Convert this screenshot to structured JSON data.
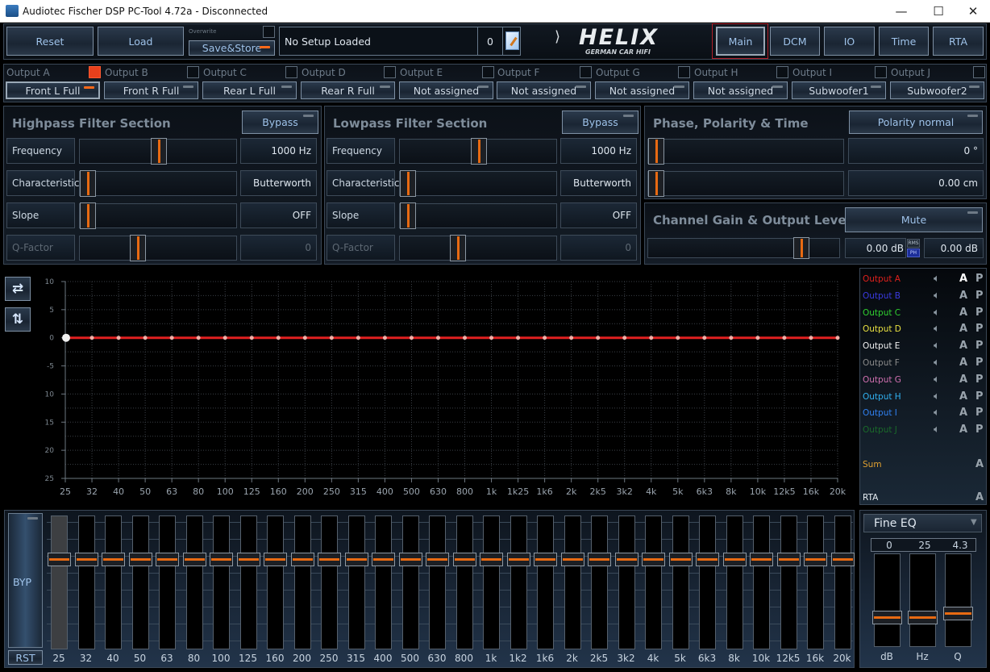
{
  "window": {
    "title": "Audiotec Fischer DSP PC-Tool 4.72a - Disconnected",
    "minimize": "—",
    "maximize": "☐",
    "close": "✕"
  },
  "toolbar": {
    "reset": "Reset",
    "load": "Load",
    "overwrite_label": "Overwrite",
    "overwrite_checked": false,
    "save_store": "Save&Store",
    "setup_name": "No Setup Loaded",
    "setup_number": "0",
    "edit_icon": "edit-document-icon",
    "logo_text": "HELIX",
    "logo_sub": "GERMAN CAR HIFI",
    "nav": [
      {
        "label": "Main",
        "active": true
      },
      {
        "label": "DCM",
        "active": false
      },
      {
        "label": "IO",
        "active": false
      },
      {
        "label": "Time",
        "active": false
      },
      {
        "label": "RTA",
        "active": false
      }
    ]
  },
  "outputs": [
    {
      "label": "Output A",
      "name": "Front L Full",
      "linked": true,
      "selected": true
    },
    {
      "label": "Output B",
      "name": "Front R Full",
      "linked": false,
      "selected": false
    },
    {
      "label": "Output C",
      "name": "Rear L Full",
      "linked": false,
      "selected": false
    },
    {
      "label": "Output D",
      "name": "Rear R Full",
      "linked": false,
      "selected": false
    },
    {
      "label": "Output E",
      "name": "Not assigned",
      "linked": false,
      "selected": false
    },
    {
      "label": "Output F",
      "name": "Not assigned",
      "linked": false,
      "selected": false
    },
    {
      "label": "Output G",
      "name": "Not assigned",
      "linked": false,
      "selected": false
    },
    {
      "label": "Output H",
      "name": "Not assigned",
      "linked": false,
      "selected": false
    },
    {
      "label": "Output I",
      "name": "Subwoofer1",
      "linked": false,
      "selected": false
    },
    {
      "label": "Output J",
      "name": "Subwoofer2",
      "linked": false,
      "selected": false
    }
  ],
  "highpass": {
    "title": "Highpass Filter Section",
    "bypass": "Bypass",
    "rows": [
      {
        "label": "Frequency",
        "value": "1000 Hz",
        "position": 0.5,
        "disabled": false
      },
      {
        "label": "Characteristic",
        "value": "Butterworth",
        "position": 0.0,
        "disabled": false
      },
      {
        "label": "Slope",
        "value": "OFF",
        "position": 0.0,
        "disabled": false
      },
      {
        "label": "Q-Factor",
        "value": "0",
        "position": 0.35,
        "disabled": true
      }
    ]
  },
  "lowpass": {
    "title": "Lowpass Filter Section",
    "bypass": "Bypass",
    "rows": [
      {
        "label": "Frequency",
        "value": "1000 Hz",
        "position": 0.5,
        "disabled": false
      },
      {
        "label": "Characteristic",
        "value": "Butterworth",
        "position": 0.0,
        "disabled": false
      },
      {
        "label": "Slope",
        "value": "OFF",
        "position": 0.0,
        "disabled": false
      },
      {
        "label": "Q-Factor",
        "value": "0",
        "position": 0.35,
        "disabled": true
      }
    ]
  },
  "phase": {
    "title": "Phase, Polarity & Time",
    "polarity": "Polarity normal",
    "rows": [
      {
        "value": "0 °",
        "position": 0.0
      },
      {
        "value": "0.00 cm",
        "position": 0.0
      }
    ]
  },
  "gain": {
    "title": "Channel Gain & Output Level",
    "mute": "Mute",
    "position": 0.82,
    "gain_value": "0.00 dB",
    "rms_label": "RMS",
    "ph_label": "PH",
    "level_value": "0.00 dB"
  },
  "graph_tools": {
    "swap_h_icon": "swap-horizontal-icon",
    "swap_v_icon": "swap-vertical-icon"
  },
  "chart_data": {
    "type": "line",
    "title": "",
    "xlabel": "",
    "ylabel": "",
    "x": [
      "25",
      "32",
      "40",
      "50",
      "63",
      "80",
      "100",
      "125",
      "160",
      "200",
      "250",
      "315",
      "400",
      "500",
      "630",
      "800",
      "1k",
      "1k25",
      "1k6",
      "2k",
      "2k5",
      "3k2",
      "4k",
      "5k",
      "6k3",
      "8k",
      "10k",
      "12k5",
      "16k",
      "20k"
    ],
    "x_hz": [
      25,
      32,
      40,
      50,
      63,
      80,
      100,
      125,
      160,
      200,
      250,
      315,
      400,
      500,
      630,
      800,
      1000,
      1250,
      1600,
      2000,
      2500,
      3200,
      4000,
      5000,
      6300,
      8000,
      10000,
      12500,
      16000,
      20000
    ],
    "ylim": [
      -25,
      10
    ],
    "yticks": [
      10,
      5,
      0,
      -5,
      -10,
      -15,
      -20,
      -25
    ],
    "grid": true,
    "series": [
      {
        "name": "Output A",
        "color": "#e02020",
        "values": [
          0,
          0,
          0,
          0,
          0,
          0,
          0,
          0,
          0,
          0,
          0,
          0,
          0,
          0,
          0,
          0,
          0,
          0,
          0,
          0,
          0,
          0,
          0,
          0,
          0,
          0,
          0,
          0,
          0,
          0
        ]
      }
    ]
  },
  "legend": {
    "items": [
      {
        "name": "Output A",
        "color": "#e0201c",
        "active": true
      },
      {
        "name": "Output B",
        "color": "#3a3ae0",
        "active": false
      },
      {
        "name": "Output C",
        "color": "#30d030",
        "active": false
      },
      {
        "name": "Output D",
        "color": "#e8e040",
        "active": false
      },
      {
        "name": "Output E",
        "color": "#f0f0f0",
        "active": false
      },
      {
        "name": "Output F",
        "color": "#8a8a8a",
        "active": false
      },
      {
        "name": "Output G",
        "color": "#d070b0",
        "active": false
      },
      {
        "name": "Output H",
        "color": "#30b0f0",
        "active": false
      },
      {
        "name": "Output I",
        "color": "#3080f0",
        "active": false
      },
      {
        "name": "Output J",
        "color": "#1a6a2a",
        "active": false
      }
    ],
    "a_label": "A",
    "p_label": "P",
    "sum": {
      "name": "Sum",
      "color": "#e0a030"
    },
    "rta": {
      "name": "RTA",
      "color": "#e8eef4"
    }
  },
  "eq": {
    "byp": "BYP",
    "rst": "RST",
    "bands": [
      "25",
      "32",
      "40",
      "50",
      "63",
      "80",
      "100",
      "125",
      "160",
      "200",
      "250",
      "315",
      "400",
      "500",
      "630",
      "800",
      "1k",
      "1k2",
      "1k6",
      "2k",
      "2k5",
      "3k2",
      "4k",
      "5k",
      "6k3",
      "8k",
      "10k",
      "12k5",
      "16k",
      "20k"
    ],
    "gains_db": [
      0,
      0,
      0,
      0,
      0,
      0,
      0,
      0,
      0,
      0,
      0,
      0,
      0,
      0,
      0,
      0,
      0,
      0,
      0,
      0,
      0,
      0,
      0,
      0,
      0,
      0,
      0,
      0,
      0,
      0
    ],
    "selected_band": 0
  },
  "fine_eq": {
    "mode": "Fine EQ",
    "values": [
      "0",
      "25",
      "4.3"
    ],
    "labels": [
      "dB",
      "Hz",
      "Q"
    ],
    "positions": [
      0.5,
      0.5,
      0.53
    ]
  }
}
